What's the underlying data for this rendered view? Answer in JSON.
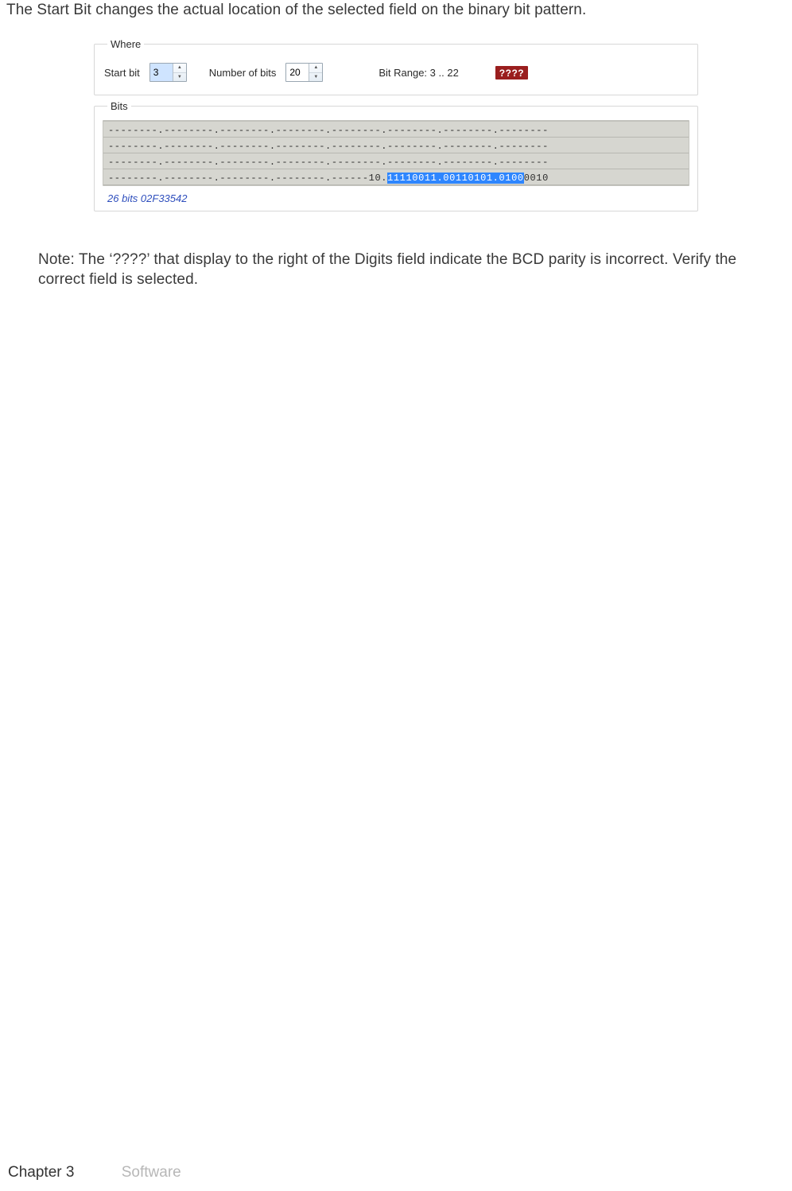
{
  "intro": "The Start Bit changes the actual location of the selected field on the binary bit pattern.",
  "where": {
    "legend": "Where",
    "start_bit_label": "Start bit",
    "start_bit_value": "3",
    "num_bits_label": "Number of bits",
    "num_bits_value": "20",
    "bit_range_label": "Bit Range: 3 .. 22",
    "error_badge": "????"
  },
  "bits": {
    "legend": "Bits",
    "rows": [
      "--------.--------.--------.--------.--------.--------.--------.--------",
      "--------.--------.--------.--------.--------.--------.--------.--------",
      "--------.--------.--------.--------.--------.--------.--------.--------"
    ],
    "row4_pre": "--------.--------.--------.--------.------10.",
    "row4_sel": "11110011.00110101.0100",
    "row4_post": "0010",
    "footer": "26 bits 02F33542"
  },
  "note": "Note: The ‘????’ that display to the right of the Digits field indicate the BCD parity is incorrect. Verify the correct field is selected.",
  "footer": {
    "chapter": "Chapter 3",
    "section": "Software"
  }
}
